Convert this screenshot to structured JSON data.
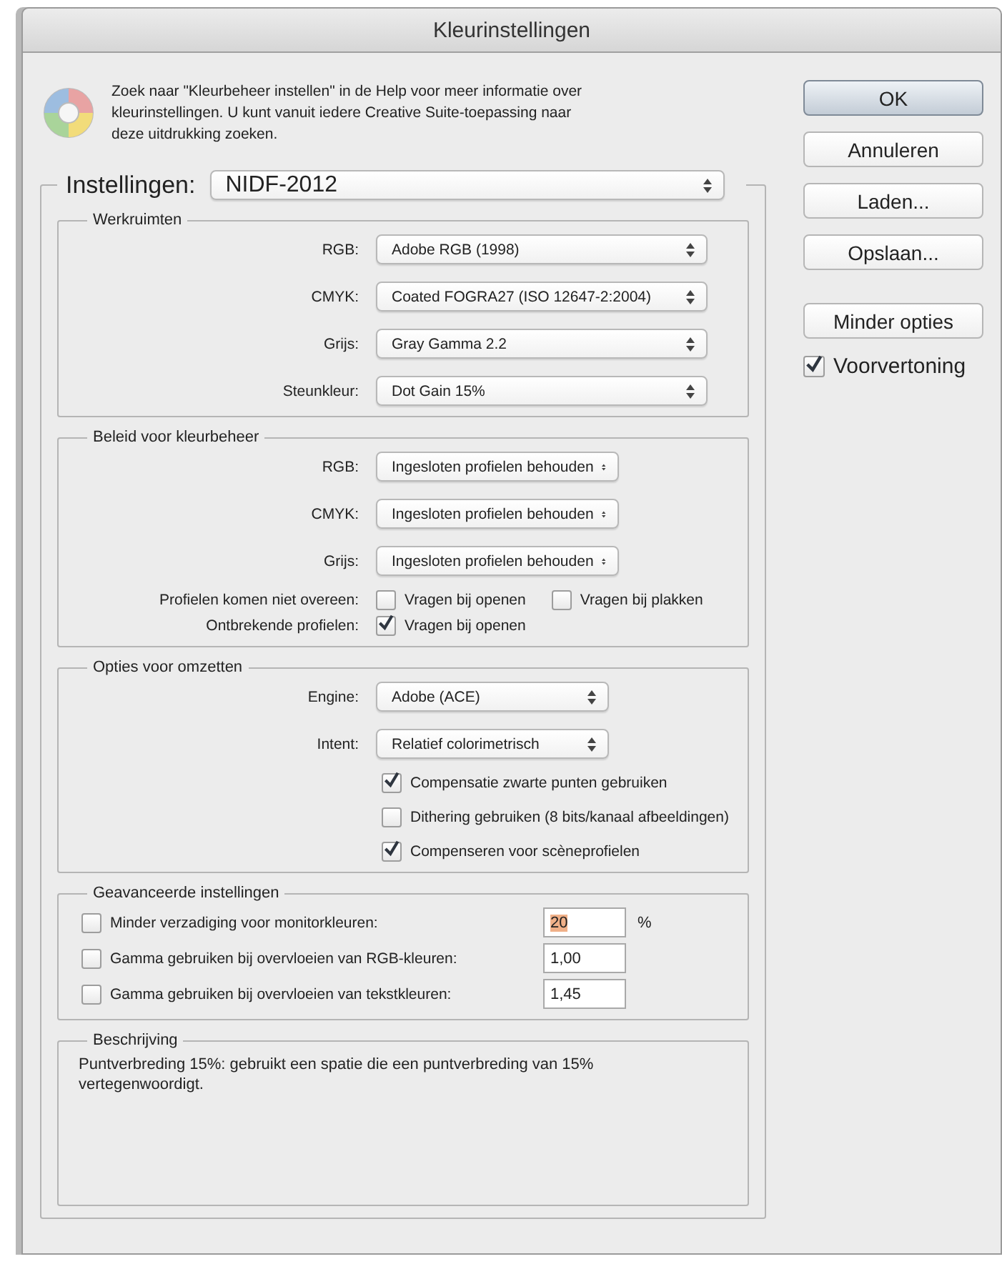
{
  "window": {
    "title": "Kleurinstellingen"
  },
  "help": {
    "text": "Zoek naar \"Kleurbeheer instellen\" in de Help voor meer informatie over kleurinstellingen. U kunt vanuit iedere Creative Suite-toepassing naar deze uitdrukking zoeken."
  },
  "settings": {
    "label": "Instellingen:",
    "value": "NIDF-2012"
  },
  "working_spaces": {
    "title": "Werkruimten",
    "rows": [
      {
        "label": "RGB:",
        "value": "Adobe RGB (1998)"
      },
      {
        "label": "CMYK:",
        "value": "Coated FOGRA27 (ISO 12647-2:2004)"
      },
      {
        "label": "Grijs:",
        "value": "Gray Gamma 2.2"
      },
      {
        "label": "Steunkleur:",
        "value": "Dot Gain 15%"
      }
    ]
  },
  "policies": {
    "title": "Beleid voor kleurbeheer",
    "rows": [
      {
        "label": "RGB:",
        "value": "Ingesloten profielen behouden"
      },
      {
        "label": "CMYK:",
        "value": "Ingesloten profielen behouden"
      },
      {
        "label": "Grijs:",
        "value": "Ingesloten profielen behouden"
      }
    ],
    "checks": [
      {
        "label": "Profielen komen niet overeen:",
        "options": [
          {
            "label": "Vragen bij openen",
            "checked": false
          },
          {
            "label": "Vragen bij plakken",
            "checked": false
          }
        ]
      },
      {
        "label": "Ontbrekende profielen:",
        "options": [
          {
            "label": "Vragen bij openen",
            "checked": true
          }
        ]
      }
    ]
  },
  "conversion": {
    "title": "Opties voor omzetten",
    "rows": [
      {
        "label": "Engine:",
        "value": "Adobe (ACE)"
      },
      {
        "label": "Intent:",
        "value": "Relatief colorimetrisch"
      }
    ],
    "options": [
      {
        "label": "Compensatie zwarte punten gebruiken",
        "checked": true
      },
      {
        "label": "Dithering gebruiken (8 bits/kanaal afbeeldingen)",
        "checked": false
      },
      {
        "label": "Compenseren voor scèneprofielen",
        "checked": true
      }
    ]
  },
  "advanced": {
    "title": "Geavanceerde instellingen",
    "rows": [
      {
        "label": "Minder verzadiging voor monitorkleuren:",
        "checked": false,
        "value": "20",
        "selected": true,
        "unit": "%"
      },
      {
        "label": "Gamma gebruiken bij overvloeien van RGB-kleuren:",
        "checked": false,
        "value": "1,00",
        "selected": false
      },
      {
        "label": "Gamma gebruiken bij overvloeien van tekstkleuren:",
        "checked": false,
        "value": "1,45",
        "selected": false
      }
    ]
  },
  "description": {
    "title": "Beschrijving",
    "text": "Puntverbreding 15%:  gebruikt een spatie die een puntverbreding van 15% vertegenwoordigt."
  },
  "buttons": [
    {
      "label": "OK",
      "default": true
    },
    {
      "label": "Annuleren",
      "default": false
    },
    {
      "label": "Laden...",
      "default": false
    },
    {
      "label": "Opslaan...",
      "default": false
    },
    {
      "label": "Minder opties",
      "default": false
    }
  ],
  "preview": {
    "label": "Voorvertoning",
    "checked": true
  }
}
